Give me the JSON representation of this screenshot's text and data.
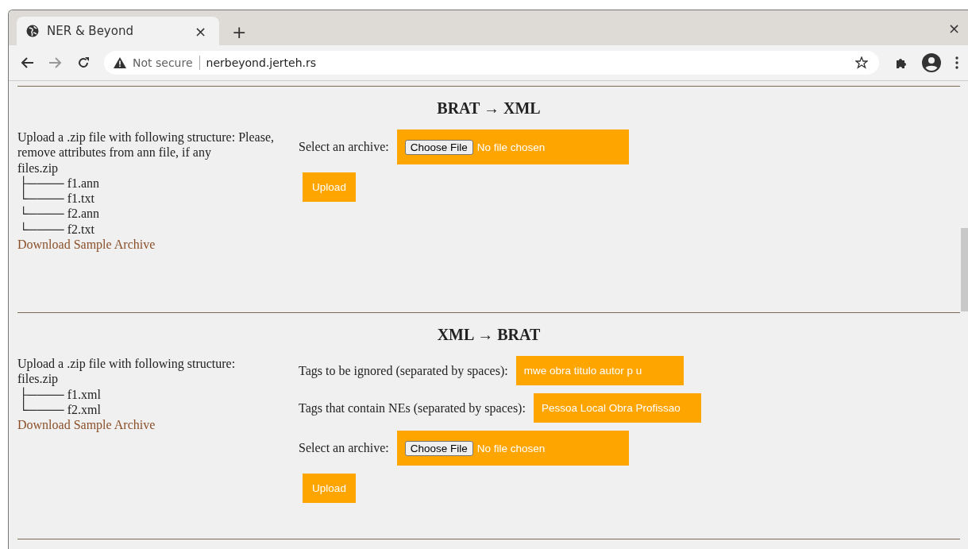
{
  "browser": {
    "tab_title": "NER & Beyond",
    "tab_close": "×",
    "new_tab": "+",
    "window_close": "×",
    "security": "Not secure",
    "url": "nerbeyond.jerteh.rs"
  },
  "sections": [
    {
      "title": "BRAT → XML",
      "description": "Upload a .zip file with following structure: Please, remove attributes from ann file, if any",
      "tree_root": "files.zip",
      "tree_items": [
        "├──── f1.ann",
        "└──── f1.txt",
        "└──── f2.ann",
        "└──── f2.txt"
      ],
      "link": "Download Sample Archive",
      "fields": [
        {
          "kind": "file",
          "label": "Select an archive:",
          "button": "Choose File",
          "value": "No file chosen"
        }
      ],
      "upload": "Upload"
    },
    {
      "title": "XML → BRAT",
      "description": "Upload a .zip file with following structure:",
      "tree_root": "files.zip",
      "tree_items": [
        "├──── f1.xml",
        "└──── f2.xml"
      ],
      "link": "Download Sample Archive",
      "fields": [
        {
          "kind": "text",
          "label": "Tags to be ignored (separated by spaces):",
          "value": "mwe obra titulo autor p u"
        },
        {
          "kind": "text",
          "label": "Tags that contain NEs (separated by spaces):",
          "value": "Pessoa Local Obra Profissao"
        },
        {
          "kind": "file",
          "label": "Select an archive:",
          "button": "Choose File",
          "value": "No file chosen"
        }
      ],
      "upload": "Upload"
    }
  ]
}
